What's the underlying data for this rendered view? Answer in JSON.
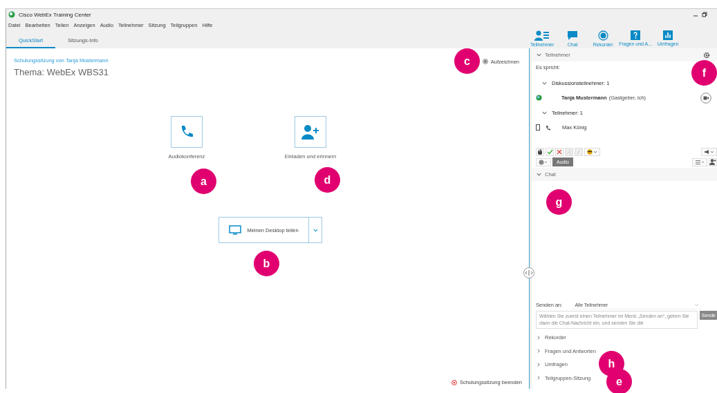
{
  "window": {
    "title": "Cisco WebEx Training Center"
  },
  "menu": [
    "Datei",
    "Bearbeiten",
    "Teilen",
    "Anzeigen",
    "Audio",
    "Teilnehmer",
    "Sitzung",
    "Teilgruppen",
    "Hilfe"
  ],
  "tabs": [
    {
      "label": "QuickStart",
      "selected": true
    },
    {
      "label": "Sitzungs-Info",
      "selected": false
    }
  ],
  "toolbar": [
    {
      "label": "Teilnehmer",
      "selected": true
    },
    {
      "label": "Chat",
      "selected": true
    },
    {
      "label": "Rekorder",
      "selected": true
    },
    {
      "label": "Fragen und A...",
      "selected": true
    },
    {
      "label": "Umfragen",
      "selected": true
    }
  ],
  "session": {
    "host_line": "Schulungssitzung von Tanja Mustermann",
    "topic": "Thema: WebEx WBS31",
    "record": "Aufzeichnen"
  },
  "actions": [
    {
      "label": "Audiokonferenz"
    },
    {
      "label": "Einladen und erinnern"
    }
  ],
  "share_button": {
    "label": "Meinen Desktop teilen"
  },
  "end_session": "Schulungssitzung beenden",
  "participants_panel": {
    "title": "Teilnehmer",
    "expanded": true,
    "speaking_label": "Es spricht:",
    "groups": [
      {
        "label": "Diskussionsteilnehmer: 1",
        "expanded": true,
        "members": [
          {
            "kind": "host",
            "name": "Tanja Mustermann",
            "role": "(Gastgeber, ich)"
          }
        ]
      },
      {
        "label": "Teilnehmer: 1",
        "expanded": true,
        "members": [
          {
            "kind": "phone",
            "name": "Max König"
          }
        ]
      }
    ]
  },
  "audio_button": "Audio",
  "chat": {
    "title": "Chat",
    "expanded": true,
    "send_to_label": "Senden an:",
    "send_to_value": "Alle Teilnehmer",
    "message_placeholder": "Wählen Sie zuerst einen Teilnehmer im Menü „Senden an“, geben Sie dann die Chat-Nachricht ein, und senden Sie die",
    "send_button": "Sende"
  },
  "collapsed_panels": [
    {
      "label": "Rekorder",
      "expanded": false
    },
    {
      "label": "Fragen und Antworten",
      "expanded": false
    },
    {
      "label": "Umfragen",
      "expanded": false
    },
    {
      "label": "Teilgruppen-Sitzung",
      "expanded": false
    }
  ],
  "callouts": [
    "a",
    "b",
    "c",
    "d",
    "e",
    "f",
    "g",
    "h"
  ]
}
